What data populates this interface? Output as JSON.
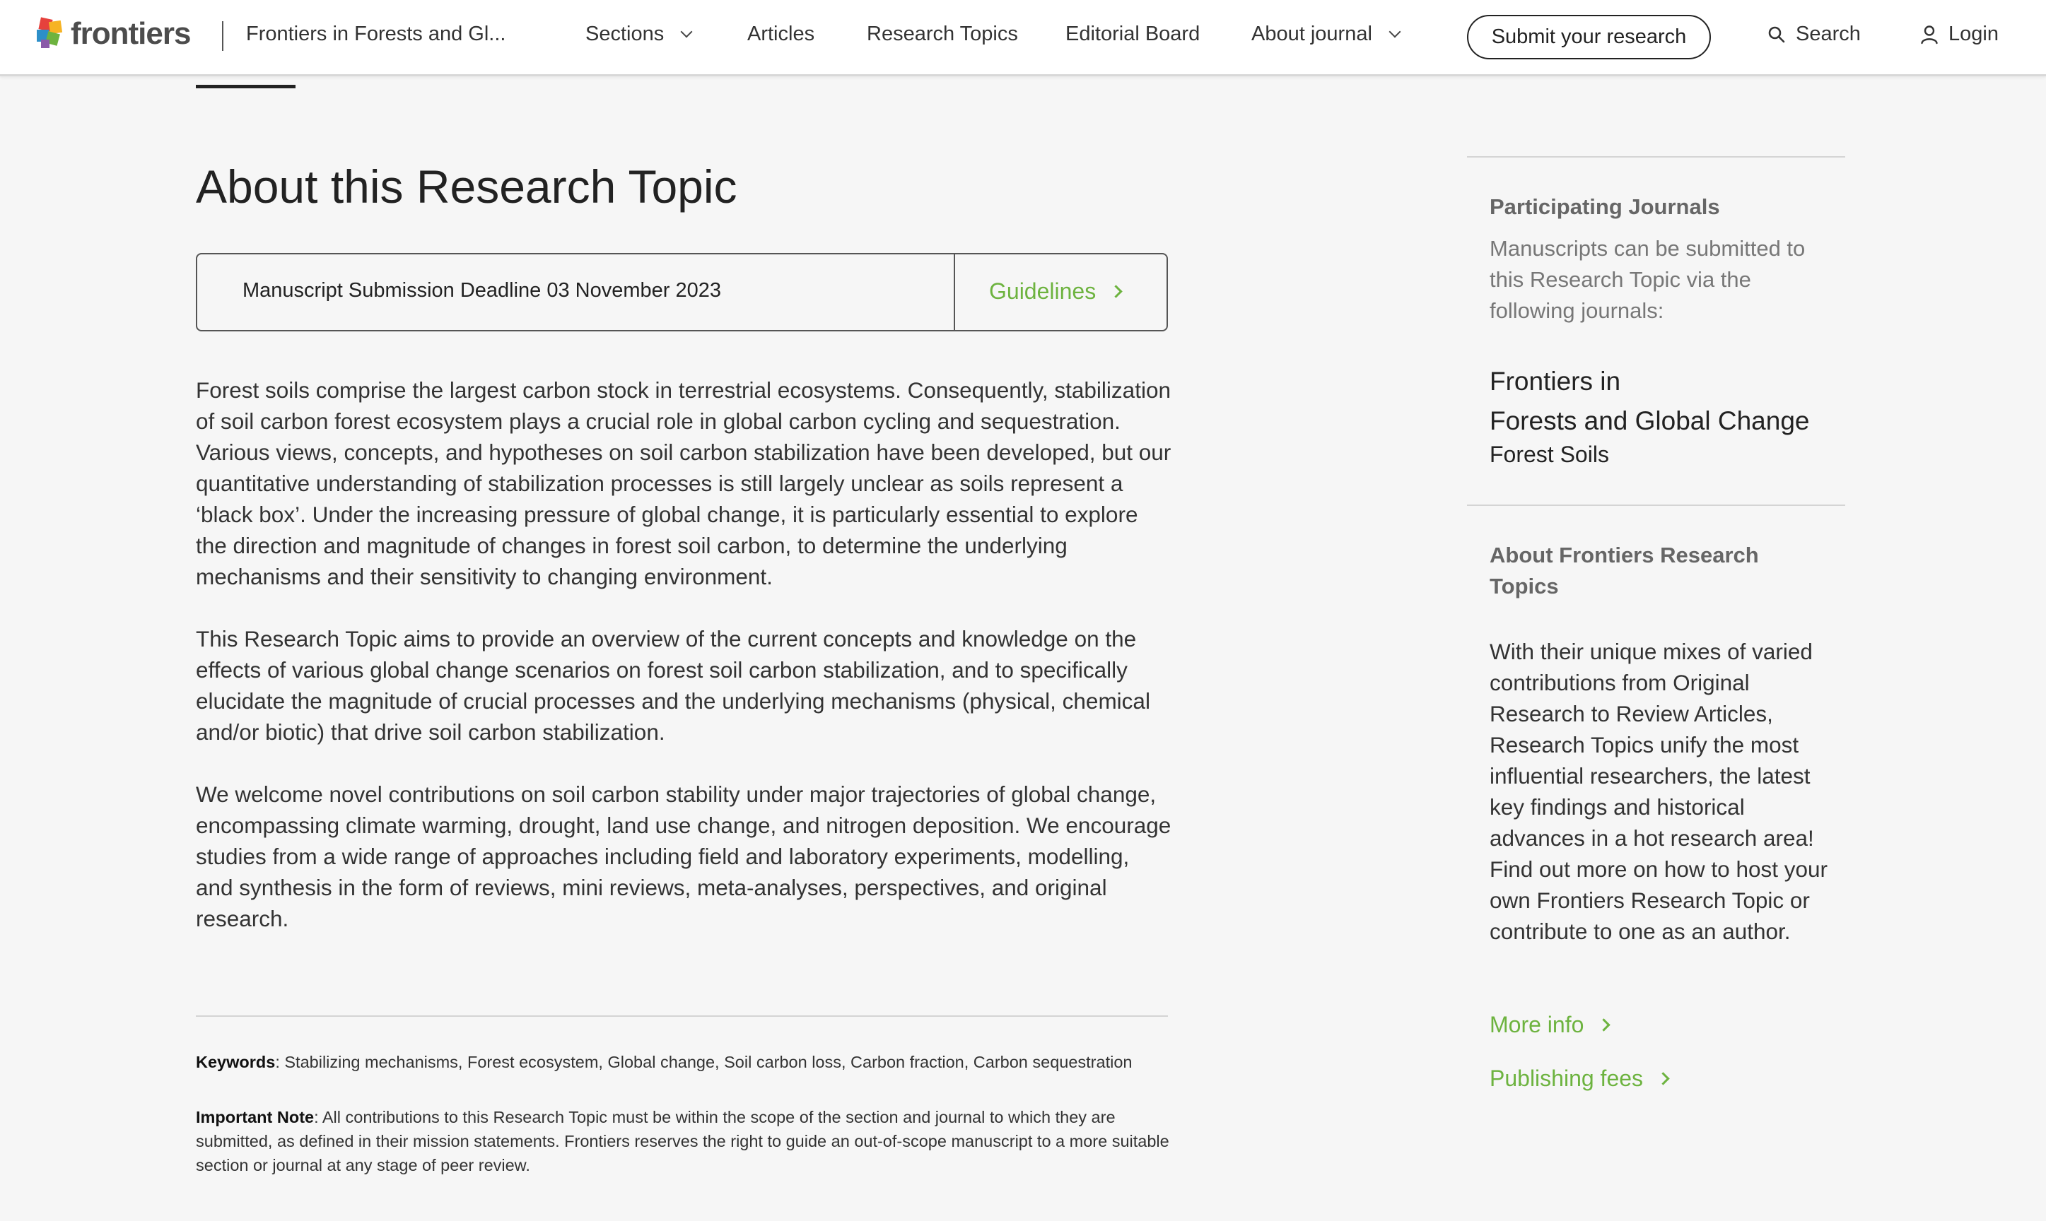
{
  "header": {
    "logo_text": "frontiers",
    "journal_name": "Frontiers in Forests and Gl...",
    "nav": [
      "Sections",
      "Articles",
      "Research Topics",
      "Editorial Board",
      "About journal"
    ],
    "submit_label": "Submit your research",
    "search_label": "Search",
    "login_label": "Login"
  },
  "main": {
    "title": "About this Research Topic",
    "deadline": "Manuscript Submission Deadline 03 November 2023",
    "guidelines_label": "Guidelines",
    "paragraphs": [
      "Forest soils comprise the largest carbon stock in terrestrial ecosystems. Consequently, stabilization of soil carbon forest ecosystem plays a crucial role in global carbon cycling and sequestration. Various views, concepts, and hypotheses on soil carbon stabilization have been developed, but our quantitative understanding of stabilization processes is still largely unclear as soils represent a ‘black box’. Under the increasing pressure of global change, it is particularly essential to explore the direction and magnitude of changes in forest soil carbon, to determine the underlying mechanisms and their sensitivity to changing environment.",
      "This Research Topic aims to provide an overview of the current concepts and knowledge on the effects of various global change scenarios on forest soil carbon stabilization, and to specifically elucidate the magnitude of crucial processes and the underlying mechanisms (physical, chemical and/or biotic) that drive soil carbon stabilization.",
      "We welcome novel contributions on soil carbon stability under major trajectories of global change, encompassing climate warming, drought, land use change, and nitrogen deposition. We encourage studies from a wide range of approaches including field and laboratory experiments, modelling, and synthesis in the form of reviews, mini reviews, meta-analyses, perspectives, and original research."
    ],
    "keywords_label": "Keywords",
    "keywords": ": Stabilizing mechanisms, Forest ecosystem, Global change, Soil carbon loss, Carbon fraction, Carbon sequestration",
    "note_label": "Important Note",
    "note": ": All contributions to this Research Topic must be within the scope of the section and journal to which they are submitted, as defined in their mission statements. Frontiers reserves the right to guide an out-of-scope manuscript to a more suitable section or journal at any stage of peer review."
  },
  "sidebar": {
    "participating_heading": "Participating Journals",
    "participating_text": "Manuscripts can be submitted to this Research Topic via the following journals:",
    "journal_line1": "Frontiers in",
    "journal_line2": "Forests and Global Change",
    "journal_section": "Forest Soils",
    "about_heading": "About Frontiers Research Topics",
    "about_text": "With their unique mixes of varied contributions from Original Research to Review Articles, Research Topics unify the most influential researchers, the latest key findings and historical advances in a hot research area! Find out more on how to host your own Frontiers Research Topic or contribute to one as an author.",
    "more_info_label": "More info",
    "fees_label": "Publishing fees"
  },
  "colors": {
    "accent_green": "#6db33f",
    "background": "#f6f6f6"
  }
}
